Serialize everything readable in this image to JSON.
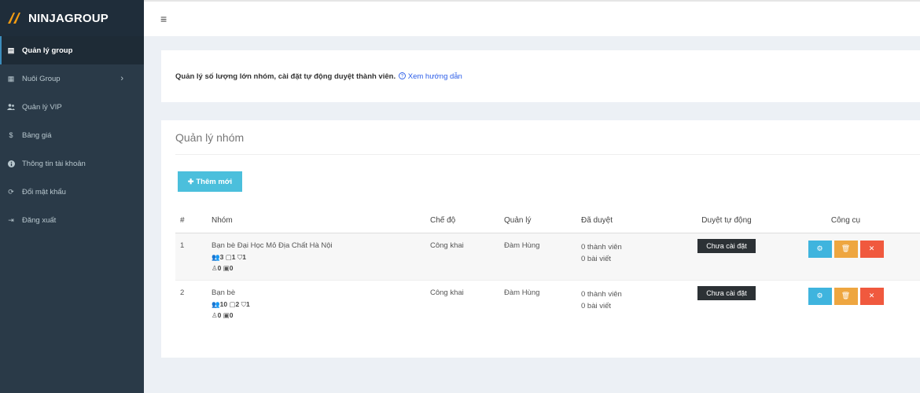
{
  "brand": {
    "name": "NINJAGROUP",
    "logo_icon": "ninja-logo-icon",
    "logo_color": "#f39c12"
  },
  "sidebar": {
    "items": [
      {
        "label": "Quản lý group",
        "icon": "database-icon",
        "glyph": "▤",
        "active": true
      },
      {
        "label": "Nuôi Group",
        "icon": "calendar-icon",
        "glyph": "▦",
        "arrow": "›"
      },
      {
        "label": "Quản lý VIP",
        "icon": "users-icon",
        "glyph": "👥"
      },
      {
        "label": "Bảng giá",
        "icon": "dollar-icon",
        "glyph": "$"
      },
      {
        "label": "Thông tin tài khoản",
        "icon": "info-icon",
        "glyph": "❶"
      },
      {
        "label": "Đổi mật khẩu",
        "icon": "refresh-icon",
        "glyph": "⟳"
      },
      {
        "label": "Đăng xuất",
        "icon": "sign-out-icon",
        "glyph": "⇥"
      }
    ]
  },
  "header": {
    "menu_toggle": "≡"
  },
  "info": {
    "text": "Quản lý số lượng lớn nhóm, cài đặt tự động duyệt thành viên.",
    "help_icon": "question-circle-icon",
    "help_glyph": "?",
    "help_link": "Xem hướng dẫn"
  },
  "panel": {
    "title": "Quản lý nhóm",
    "add_button": "Thêm mới",
    "add_glyph": "✚",
    "columns": [
      "#",
      "Nhóm",
      "Chế độ",
      "Quản lý",
      "Đã duyệt",
      "Duyệt tự động",
      "Công cụ"
    ],
    "rows": [
      {
        "num": "1",
        "name": "Bạn bè Đại Học Mỏ Địa Chất Hà Nội",
        "members": "3",
        "posts": "1",
        "admins": "1",
        "pending": "0",
        "photos": "0",
        "mode": "Công khai",
        "admin": "Đàm Hùng",
        "approved_members": "0 thành viên",
        "approved_posts": "0 bài viết",
        "auto_status": "Chưa cài đặt"
      },
      {
        "num": "2",
        "name": "Bạn bè",
        "members": "10",
        "posts": "2",
        "admins": "1",
        "pending": "0",
        "photos": "0",
        "mode": "Công khai",
        "admin": "Đàm Hùng",
        "approved_members": "0 thành viên",
        "approved_posts": "0 bài viết",
        "auto_status": "Chưa cài đặt"
      }
    ]
  },
  "colors": {
    "sidebar_bg": "#2a3a48",
    "brand_bg": "#1f2d3a",
    "accent_info": "#4bbfdc",
    "tool_settings": "#3fb4de",
    "tool_delete": "#eea640",
    "tool_remove": "#f0593e",
    "status_dark": "#2c3135"
  }
}
